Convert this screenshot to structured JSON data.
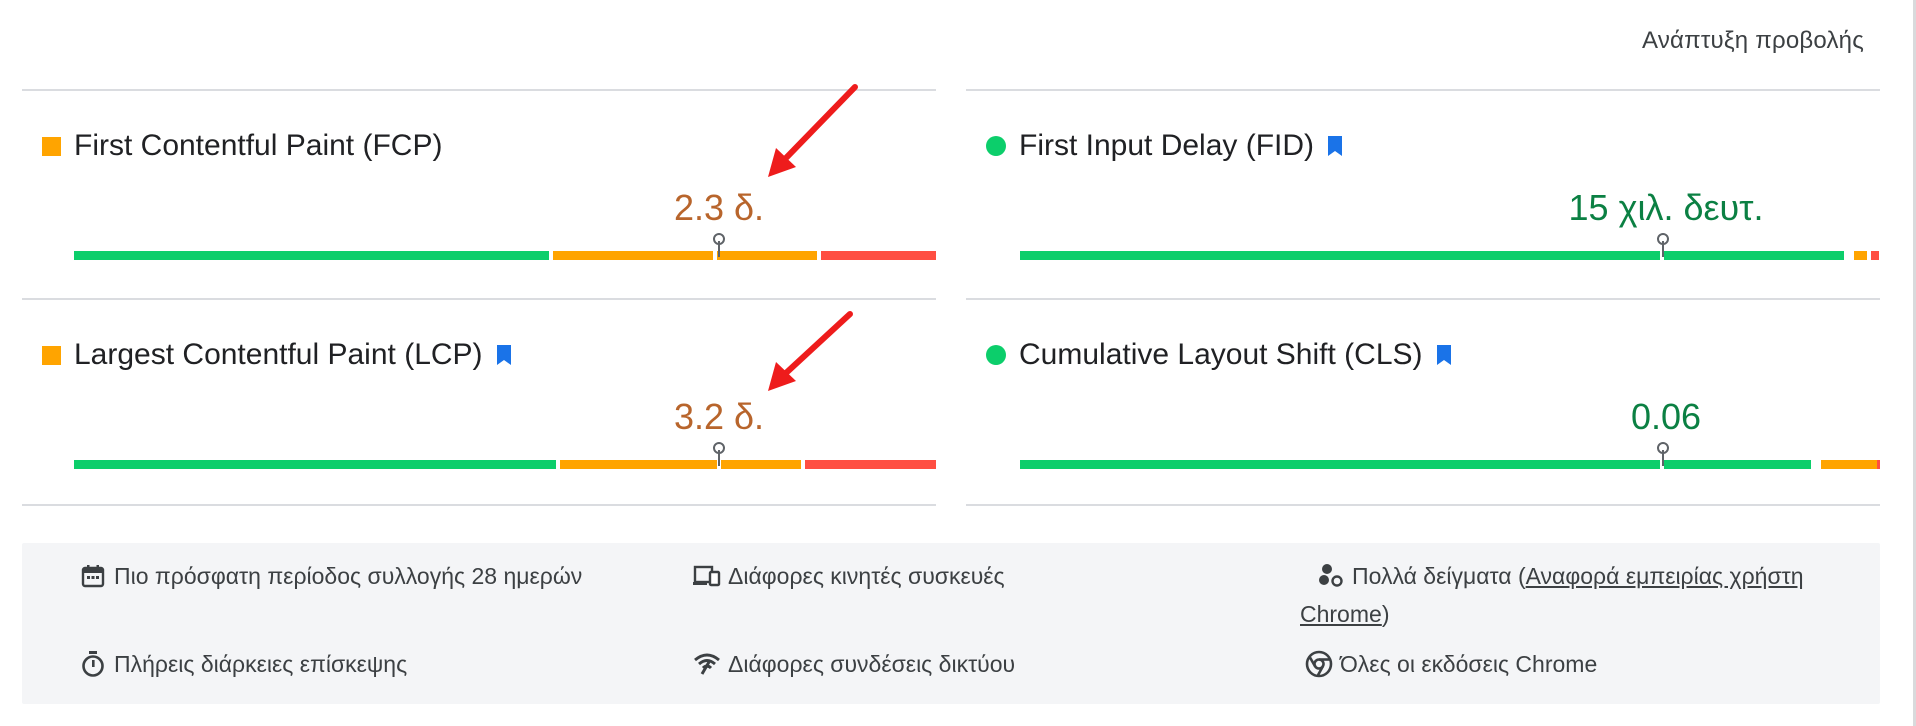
{
  "header": {
    "expand_label": "Ανάπτυξη προβολής"
  },
  "metrics": {
    "fcp": {
      "title": "First Contentful Paint (FCP)",
      "value": "2.3 δ.",
      "status": "average",
      "bookmark": false
    },
    "fid": {
      "title": "First Input Delay (FID)",
      "value": "15 χιλ. δευτ.",
      "status": "good",
      "bookmark": true
    },
    "lcp": {
      "title": "Largest Contentful Paint (LCP)",
      "value": "3.2 δ.",
      "status": "average",
      "bookmark": true
    },
    "cls": {
      "title": "Cumulative Layout Shift (CLS)",
      "value": "0.06",
      "status": "good",
      "bookmark": true
    }
  },
  "footer": {
    "period": "Πιο πρόσφατη περίοδος συλλογής 28 ημερών",
    "devices": "Διάφορες κινητές συσκευές",
    "samples_prefix": "Πολλά δείγματα (",
    "samples_link": "Αναφορά εμπειρίας χρήστη Chrome",
    "samples_suffix": ")",
    "duration": "Πλήρεις διάρκειες επίσκεψης",
    "network": "Διάφορες συνδέσεις δικτύου",
    "chrome_versions": "Όλες οι εκδόσεις Chrome"
  },
  "colors": {
    "good": "#0cce6b",
    "average": "#ffa400",
    "poor": "#ff4e42",
    "average_text": "#b8652c",
    "good_text": "#0b8043",
    "bookmark": "#1a73e8",
    "annotation_arrow": "#ee1c1c"
  },
  "icons": [
    "square-average-icon",
    "circle-good-icon",
    "bookmark-icon",
    "calendar-icon",
    "devices-icon",
    "samples-icon",
    "timer-icon",
    "network-icon",
    "chrome-icon",
    "annotation-arrow-icon"
  ]
}
